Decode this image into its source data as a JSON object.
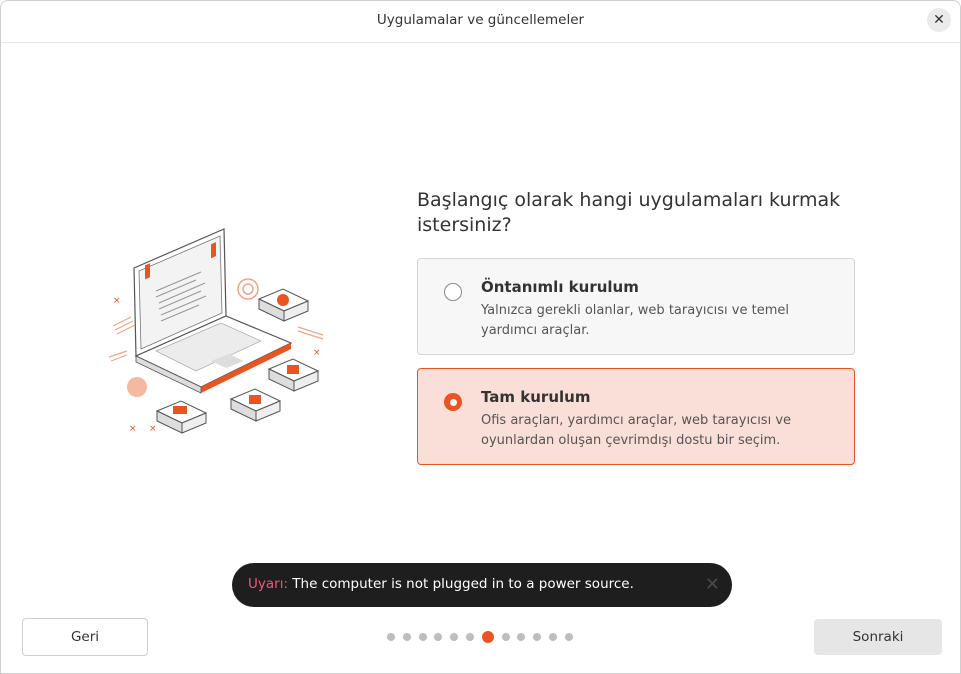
{
  "window": {
    "title": "Uygulamalar ve güncellemeler"
  },
  "question": "Başlangıç olarak hangi uygulamaları kurmak istersiniz?",
  "options": [
    {
      "title": "Öntanımlı kurulum",
      "description": "Yalnızca gerekli olanlar, web tarayıcısı ve temel yardımcı araçlar.",
      "selected": false
    },
    {
      "title": "Tam kurulum",
      "description": "Ofis araçları, yardımcı araçlar, web tarayıcısı ve oyunlardan oluşan çevrimdışı dostu bir seçim.",
      "selected": true
    }
  ],
  "toast": {
    "label": "Uyarı:",
    "message": "The computer is not plugged in to a power source."
  },
  "nav": {
    "back_label": "Geri",
    "next_label": "Sonraki"
  },
  "progress": {
    "total_steps": 12,
    "current_step": 7
  },
  "colors": {
    "accent": "#e95420",
    "selected_bg": "#fadfd8",
    "toast_bg": "#1e1e1e",
    "toast_label": "#e85a78"
  },
  "icons": [
    "close-icon",
    "laptop-illustration"
  ]
}
